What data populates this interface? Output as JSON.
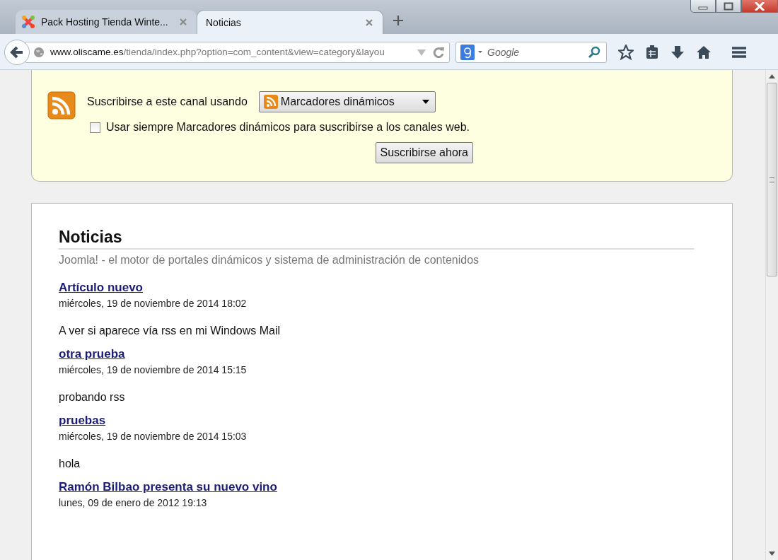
{
  "tabs": [
    {
      "label": "Pack Hosting Tienda Winte...",
      "selected": false,
      "kind": "favicon"
    },
    {
      "label": "Noticias",
      "selected": true,
      "kind": "plain"
    }
  ],
  "address_bar": {
    "domain": "www.oliscame.es",
    "path": "/tienda/index.php?option=com_content&view=category&layou"
  },
  "search": {
    "placeholder": "Google"
  },
  "feed_box": {
    "subscribe_label": "Suscribirse a este canal usando",
    "reader": "Marcadores dinámicos",
    "always_use": {
      "label": "Usar siempre Marcadores dinámicos para suscribirse a los canales web.",
      "checked": false
    },
    "button": "Suscribirse ahora"
  },
  "content": {
    "title": "Noticias",
    "subtitle": "Joomla! - el motor de portales dinámicos y sistema de administración de contenidos",
    "articles": [
      {
        "title": "Artículo nuevo",
        "date": "miércoles, 19 de noviembre de 2014 18:02",
        "text": "A ver si aparece vía rss en mi Windows Mail"
      },
      {
        "title": "otra prueba",
        "date": "miércoles, 19 de noviembre de 2014 15:15",
        "text": "probando rss"
      },
      {
        "title": "pruebas",
        "date": "miércoles, 19 de noviembre de 2014 15:03",
        "text": "hola"
      },
      {
        "title": "Ramón Bilbao presenta su nuevo vino",
        "date": "lunes, 09 de enero de 2012 19:13"
      }
    ]
  }
}
